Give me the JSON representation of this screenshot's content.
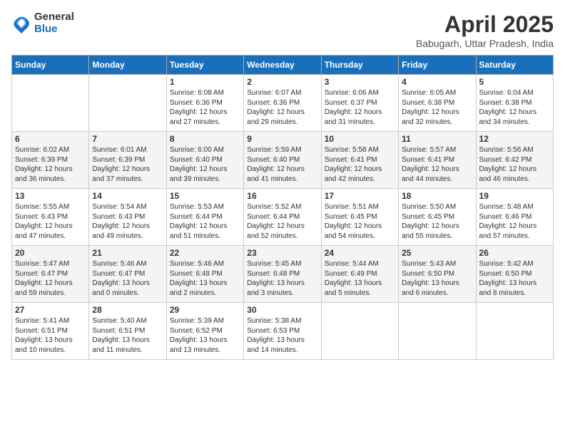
{
  "header": {
    "logo_line1": "General",
    "logo_line2": "Blue",
    "title": "April 2025",
    "subtitle": "Babugarh, Uttar Pradesh, India"
  },
  "days_of_week": [
    "Sunday",
    "Monday",
    "Tuesday",
    "Wednesday",
    "Thursday",
    "Friday",
    "Saturday"
  ],
  "weeks": [
    [
      {
        "day": "",
        "info": ""
      },
      {
        "day": "",
        "info": ""
      },
      {
        "day": "1",
        "info": "Sunrise: 6:08 AM\nSunset: 6:36 PM\nDaylight: 12 hours and 27 minutes."
      },
      {
        "day": "2",
        "info": "Sunrise: 6:07 AM\nSunset: 6:36 PM\nDaylight: 12 hours and 29 minutes."
      },
      {
        "day": "3",
        "info": "Sunrise: 6:06 AM\nSunset: 6:37 PM\nDaylight: 12 hours and 31 minutes."
      },
      {
        "day": "4",
        "info": "Sunrise: 6:05 AM\nSunset: 6:38 PM\nDaylight: 12 hours and 32 minutes."
      },
      {
        "day": "5",
        "info": "Sunrise: 6:04 AM\nSunset: 6:38 PM\nDaylight: 12 hours and 34 minutes."
      }
    ],
    [
      {
        "day": "6",
        "info": "Sunrise: 6:02 AM\nSunset: 6:39 PM\nDaylight: 12 hours and 36 minutes."
      },
      {
        "day": "7",
        "info": "Sunrise: 6:01 AM\nSunset: 6:39 PM\nDaylight: 12 hours and 37 minutes."
      },
      {
        "day": "8",
        "info": "Sunrise: 6:00 AM\nSunset: 6:40 PM\nDaylight: 12 hours and 39 minutes."
      },
      {
        "day": "9",
        "info": "Sunrise: 5:59 AM\nSunset: 6:40 PM\nDaylight: 12 hours and 41 minutes."
      },
      {
        "day": "10",
        "info": "Sunrise: 5:58 AM\nSunset: 6:41 PM\nDaylight: 12 hours and 42 minutes."
      },
      {
        "day": "11",
        "info": "Sunrise: 5:57 AM\nSunset: 6:41 PM\nDaylight: 12 hours and 44 minutes."
      },
      {
        "day": "12",
        "info": "Sunrise: 5:56 AM\nSunset: 6:42 PM\nDaylight: 12 hours and 46 minutes."
      }
    ],
    [
      {
        "day": "13",
        "info": "Sunrise: 5:55 AM\nSunset: 6:43 PM\nDaylight: 12 hours and 47 minutes."
      },
      {
        "day": "14",
        "info": "Sunrise: 5:54 AM\nSunset: 6:43 PM\nDaylight: 12 hours and 49 minutes."
      },
      {
        "day": "15",
        "info": "Sunrise: 5:53 AM\nSunset: 6:44 PM\nDaylight: 12 hours and 51 minutes."
      },
      {
        "day": "16",
        "info": "Sunrise: 5:52 AM\nSunset: 6:44 PM\nDaylight: 12 hours and 52 minutes."
      },
      {
        "day": "17",
        "info": "Sunrise: 5:51 AM\nSunset: 6:45 PM\nDaylight: 12 hours and 54 minutes."
      },
      {
        "day": "18",
        "info": "Sunrise: 5:50 AM\nSunset: 6:45 PM\nDaylight: 12 hours and 55 minutes."
      },
      {
        "day": "19",
        "info": "Sunrise: 5:48 AM\nSunset: 6:46 PM\nDaylight: 12 hours and 57 minutes."
      }
    ],
    [
      {
        "day": "20",
        "info": "Sunrise: 5:47 AM\nSunset: 6:47 PM\nDaylight: 12 hours and 59 minutes."
      },
      {
        "day": "21",
        "info": "Sunrise: 5:46 AM\nSunset: 6:47 PM\nDaylight: 13 hours and 0 minutes."
      },
      {
        "day": "22",
        "info": "Sunrise: 5:46 AM\nSunset: 6:48 PM\nDaylight: 13 hours and 2 minutes."
      },
      {
        "day": "23",
        "info": "Sunrise: 5:45 AM\nSunset: 6:48 PM\nDaylight: 13 hours and 3 minutes."
      },
      {
        "day": "24",
        "info": "Sunrise: 5:44 AM\nSunset: 6:49 PM\nDaylight: 13 hours and 5 minutes."
      },
      {
        "day": "25",
        "info": "Sunrise: 5:43 AM\nSunset: 6:50 PM\nDaylight: 13 hours and 6 minutes."
      },
      {
        "day": "26",
        "info": "Sunrise: 5:42 AM\nSunset: 6:50 PM\nDaylight: 13 hours and 8 minutes."
      }
    ],
    [
      {
        "day": "27",
        "info": "Sunrise: 5:41 AM\nSunset: 6:51 PM\nDaylight: 13 hours and 10 minutes."
      },
      {
        "day": "28",
        "info": "Sunrise: 5:40 AM\nSunset: 6:51 PM\nDaylight: 13 hours and 11 minutes."
      },
      {
        "day": "29",
        "info": "Sunrise: 5:39 AM\nSunset: 6:52 PM\nDaylight: 13 hours and 13 minutes."
      },
      {
        "day": "30",
        "info": "Sunrise: 5:38 AM\nSunset: 6:53 PM\nDaylight: 13 hours and 14 minutes."
      },
      {
        "day": "",
        "info": ""
      },
      {
        "day": "",
        "info": ""
      },
      {
        "day": "",
        "info": ""
      }
    ]
  ]
}
